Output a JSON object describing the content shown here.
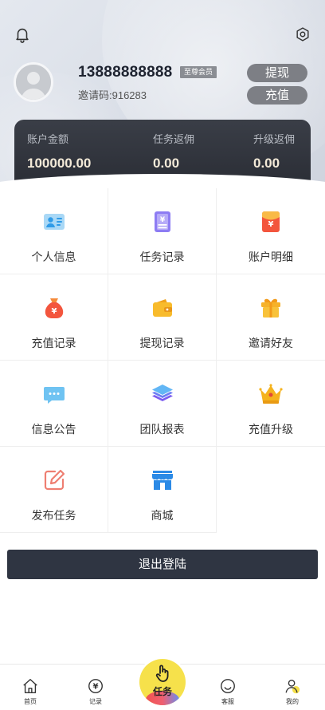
{
  "profile": {
    "phone": "13888888888",
    "vip_badge": "至尊会员",
    "invite_code": "邀请码:916283"
  },
  "actions": {
    "withdraw": "提现",
    "recharge": "充值"
  },
  "balance": {
    "items": [
      {
        "label": "账户金额",
        "value": "100000.00"
      },
      {
        "label": "任务返佣",
        "value": "0.00"
      },
      {
        "label": "升级返佣",
        "value": "0.00"
      }
    ]
  },
  "menu": [
    {
      "label": "个人信息",
      "icon": "id-card-icon"
    },
    {
      "label": "任务记录",
      "icon": "document-icon"
    },
    {
      "label": "账户明细",
      "icon": "red-envelope-icon"
    },
    {
      "label": "充值记录",
      "icon": "money-bag-icon"
    },
    {
      "label": "提现记录",
      "icon": "wallet-icon"
    },
    {
      "label": "邀请好友",
      "icon": "gift-icon"
    },
    {
      "label": "信息公告",
      "icon": "message-icon"
    },
    {
      "label": "团队报表",
      "icon": "layers-icon"
    },
    {
      "label": "充值升级",
      "icon": "crown-icon"
    },
    {
      "label": "发布任务",
      "icon": "edit-icon"
    },
    {
      "label": "商城",
      "icon": "shop-icon"
    }
  ],
  "logout": "退出登陆",
  "tabbar": {
    "items": [
      {
        "label": "首页",
        "icon": "home-icon"
      },
      {
        "label": "记录",
        "icon": "yen-circle-icon"
      },
      {
        "label": "任务",
        "icon": "tap-hand-icon"
      },
      {
        "label": "客服",
        "icon": "smile-icon"
      },
      {
        "label": "我的",
        "icon": "user-icon"
      }
    ]
  },
  "colors": {
    "balance_card": "#2b2e36",
    "logout_button": "#2f3542",
    "center_tab": "#f6e14b",
    "pill_button": "#7d7f85"
  }
}
